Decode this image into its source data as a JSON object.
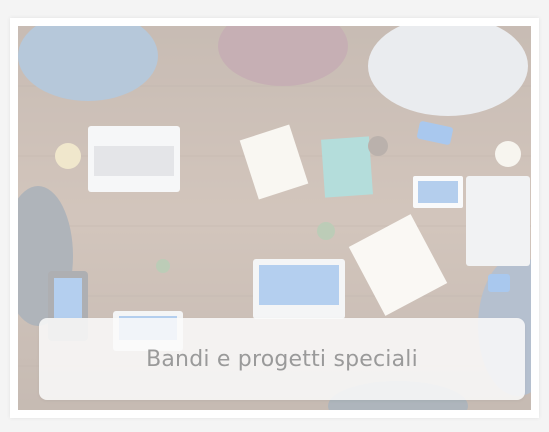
{
  "card": {
    "label": "Bandi e progetti speciali",
    "image_icon": "team-meeting-photo"
  },
  "colors": {
    "page_background": "#f4f4f4",
    "card_background": "#ffffff",
    "caption_text": "#9a9a9a",
    "caption_background": "#fafafa"
  }
}
